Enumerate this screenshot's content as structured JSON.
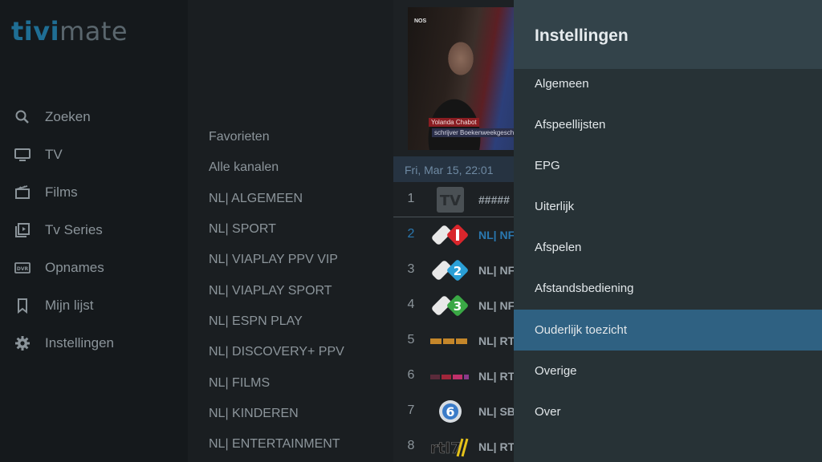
{
  "app": {
    "logo_part1": "tivi",
    "logo_part2": "mate"
  },
  "nav": {
    "items": [
      {
        "label": "Zoeken",
        "icon": "search-icon"
      },
      {
        "label": "TV",
        "icon": "tv-icon"
      },
      {
        "label": "Films",
        "icon": "film-icon"
      },
      {
        "label": "Tv Series",
        "icon": "series-icon"
      },
      {
        "label": "Opnames",
        "icon": "dvr-icon"
      },
      {
        "label": "Mijn lijst",
        "icon": "bookmark-icon"
      },
      {
        "label": "Instellingen",
        "icon": "gear-icon"
      }
    ]
  },
  "groups": [
    "Favorieten",
    "Alle kanalen",
    "NL| ALGEMEEN",
    "NL| SPORT",
    "NL| VIAPLAY PPV VIP",
    "NL| VIAPLAY SPORT",
    "NL| ESPN PLAY",
    "NL| DISCOVERY+ PPV",
    "NL| FILMS",
    "NL| KINDEREN",
    "NL| ENTERTAINMENT"
  ],
  "preview": {
    "broadcaster": "NOS",
    "caption_name": "Yolanda Chabot",
    "caption_role": "schrijver Boekenweekgesch"
  },
  "channels": {
    "date_time": "Fri, Mar 15, 22:01",
    "rows": [
      {
        "num": "1",
        "name": "#####",
        "logo": "tv-placeholder-logo"
      },
      {
        "num": "2",
        "name": "NL| NF",
        "logo": "npo1-logo"
      },
      {
        "num": "3",
        "name": "NL| NF",
        "logo": "npo2-logo"
      },
      {
        "num": "4",
        "name": "NL| NF",
        "logo": "npo3-logo"
      },
      {
        "num": "5",
        "name": "NL| RT",
        "logo": "rtl4-logo"
      },
      {
        "num": "6",
        "name": "NL| RT",
        "logo": "rtl5-logo"
      },
      {
        "num": "7",
        "name": "NL| SB",
        "logo": "sbs6-logo"
      },
      {
        "num": "8",
        "name": "NL| RT",
        "logo": "rtl7-logo"
      }
    ]
  },
  "settings": {
    "title": "Instellingen",
    "items": [
      "Algemeen",
      "Afspeellijsten",
      "EPG",
      "Uiterlijk",
      "Afspelen",
      "Afstandsbediening",
      "Ouderlijk toezicht",
      "Overige",
      "Over"
    ],
    "selected": "Ouderlijk toezicht"
  },
  "colors": {
    "accent": "#2f6182",
    "logo_blue": "#1f6e94",
    "active_channel": "#2a78b0"
  }
}
